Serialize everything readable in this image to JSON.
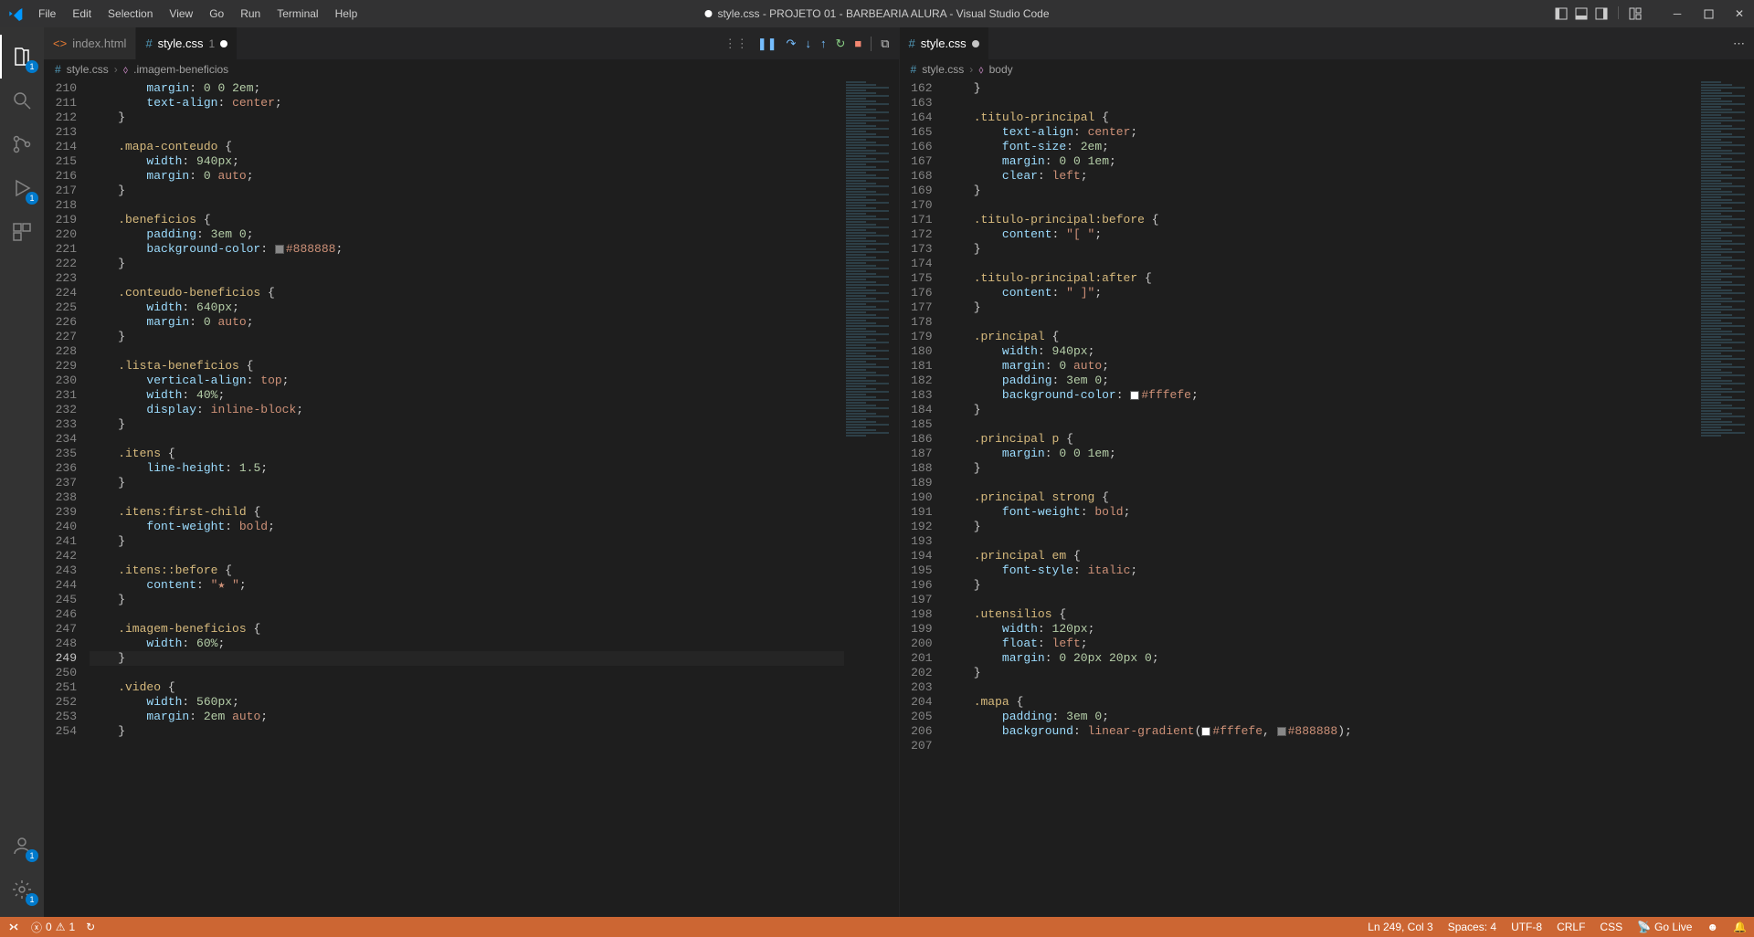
{
  "menu": [
    "File",
    "Edit",
    "Selection",
    "View",
    "Go",
    "Run",
    "Terminal",
    "Help"
  ],
  "window_title": "style.css - PROJETO 01 - BARBEARIA ALURA - Visual Studio Code",
  "activity": {
    "explorer_badge": "1",
    "debug_badge": "1",
    "accounts_badge": "1",
    "settings_badge": "1"
  },
  "left_editor": {
    "tabs": [
      {
        "icon": "html",
        "label": "index.html",
        "dirty": false
      },
      {
        "icon": "css",
        "label": "style.css",
        "num": "1",
        "dirty": true
      }
    ],
    "breadcrumb": {
      "file": "style.css",
      "symbol": ".imagem-beneficios"
    },
    "first_line": 210,
    "current_line": 249,
    "lines": [
      {
        "t": "prop",
        "raw": "        margin: 0 0 2em;"
      },
      {
        "t": "prop",
        "raw": "        text-align: center;"
      },
      {
        "t": "brace",
        "raw": "    }"
      },
      {
        "t": "",
        "raw": ""
      },
      {
        "t": "sel",
        "raw": "    .mapa-conteudo {"
      },
      {
        "t": "prop",
        "raw": "        width: 940px;"
      },
      {
        "t": "prop",
        "raw": "        margin: 0 auto;"
      },
      {
        "t": "brace",
        "raw": "    }"
      },
      {
        "t": "",
        "raw": ""
      },
      {
        "t": "sel",
        "raw": "    .beneficios {"
      },
      {
        "t": "prop",
        "raw": "        padding: 3em 0;"
      },
      {
        "t": "color",
        "raw": "        background-color: #888888;",
        "swatch": "#888888"
      },
      {
        "t": "brace",
        "raw": "    }"
      },
      {
        "t": "",
        "raw": ""
      },
      {
        "t": "sel",
        "raw": "    .conteudo-beneficios {"
      },
      {
        "t": "prop",
        "raw": "        width: 640px;"
      },
      {
        "t": "prop",
        "raw": "        margin: 0 auto;"
      },
      {
        "t": "brace",
        "raw": "    }"
      },
      {
        "t": "",
        "raw": ""
      },
      {
        "t": "sel",
        "raw": "    .lista-beneficios {"
      },
      {
        "t": "prop",
        "raw": "        vertical-align: top;"
      },
      {
        "t": "prop",
        "raw": "        width: 40%;"
      },
      {
        "t": "prop",
        "raw": "        display: inline-block;"
      },
      {
        "t": "brace",
        "raw": "    }"
      },
      {
        "t": "",
        "raw": ""
      },
      {
        "t": "sel",
        "raw": "    .itens {"
      },
      {
        "t": "prop",
        "raw": "        line-height: 1.5;"
      },
      {
        "t": "brace",
        "raw": "    }"
      },
      {
        "t": "",
        "raw": ""
      },
      {
        "t": "sel",
        "raw": "    .itens:first-child {"
      },
      {
        "t": "prop",
        "raw": "        font-weight: bold;"
      },
      {
        "t": "brace",
        "raw": "    }"
      },
      {
        "t": "",
        "raw": ""
      },
      {
        "t": "sel",
        "raw": "    .itens::before {"
      },
      {
        "t": "str",
        "raw": "        content: \"★ \";"
      },
      {
        "t": "brace",
        "raw": "    }"
      },
      {
        "t": "",
        "raw": ""
      },
      {
        "t": "sel",
        "raw": "    .imagem-beneficios {"
      },
      {
        "t": "prop",
        "raw": "        width: 60%;"
      },
      {
        "t": "brace",
        "raw": "    }"
      },
      {
        "t": "",
        "raw": ""
      },
      {
        "t": "sel",
        "raw": "    .video {"
      },
      {
        "t": "prop",
        "raw": "        width: 560px;"
      },
      {
        "t": "prop",
        "raw": "        margin: 2em auto;"
      },
      {
        "t": "brace",
        "raw": "    }"
      }
    ]
  },
  "right_editor": {
    "tab": {
      "icon": "css",
      "label": "style.css"
    },
    "breadcrumb": {
      "file": "style.css",
      "symbol": "body"
    },
    "first_line": 162,
    "lines": [
      {
        "t": "brace",
        "raw": "    }"
      },
      {
        "t": "",
        "raw": ""
      },
      {
        "t": "sel",
        "raw": "    .titulo-principal {"
      },
      {
        "t": "prop",
        "raw": "        text-align: center;"
      },
      {
        "t": "prop",
        "raw": "        font-size: 2em;"
      },
      {
        "t": "prop",
        "raw": "        margin: 0 0 1em;"
      },
      {
        "t": "prop",
        "raw": "        clear: left;"
      },
      {
        "t": "brace",
        "raw": "    }"
      },
      {
        "t": "",
        "raw": ""
      },
      {
        "t": "sel",
        "raw": "    .titulo-principal:before {"
      },
      {
        "t": "str",
        "raw": "        content: \"[ \";"
      },
      {
        "t": "brace",
        "raw": "    }"
      },
      {
        "t": "",
        "raw": ""
      },
      {
        "t": "sel",
        "raw": "    .titulo-principal:after {"
      },
      {
        "t": "str",
        "raw": "        content: \" ]\";"
      },
      {
        "t": "brace",
        "raw": "    }"
      },
      {
        "t": "",
        "raw": ""
      },
      {
        "t": "sel",
        "raw": "    .principal {"
      },
      {
        "t": "prop",
        "raw": "        width: 940px;"
      },
      {
        "t": "prop",
        "raw": "        margin: 0 auto;"
      },
      {
        "t": "prop",
        "raw": "        padding: 3em 0;"
      },
      {
        "t": "color",
        "raw": "        background-color: #fffefe;",
        "swatch": "#fffefe"
      },
      {
        "t": "brace",
        "raw": "    }"
      },
      {
        "t": "",
        "raw": ""
      },
      {
        "t": "sel",
        "raw": "    .principal p {"
      },
      {
        "t": "prop",
        "raw": "        margin: 0 0 1em;"
      },
      {
        "t": "brace",
        "raw": "    }"
      },
      {
        "t": "",
        "raw": ""
      },
      {
        "t": "sel",
        "raw": "    .principal strong {"
      },
      {
        "t": "prop",
        "raw": "        font-weight: bold;"
      },
      {
        "t": "brace",
        "raw": "    }"
      },
      {
        "t": "",
        "raw": ""
      },
      {
        "t": "sel",
        "raw": "    .principal em {"
      },
      {
        "t": "prop",
        "raw": "        font-style: italic;"
      },
      {
        "t": "brace",
        "raw": "    }"
      },
      {
        "t": "",
        "raw": ""
      },
      {
        "t": "sel",
        "raw": "    .utensilios {"
      },
      {
        "t": "prop",
        "raw": "        width: 120px;"
      },
      {
        "t": "prop",
        "raw": "        float: left;"
      },
      {
        "t": "prop",
        "raw": "        margin: 0 20px 20px 0;"
      },
      {
        "t": "brace",
        "raw": "    }"
      },
      {
        "t": "",
        "raw": ""
      },
      {
        "t": "sel",
        "raw": "    .mapa {"
      },
      {
        "t": "prop",
        "raw": "        padding: 3em 0;"
      },
      {
        "t": "color2",
        "raw": "        background: linear-gradient(#fffefe, #888888);",
        "sw1": "#fffefe",
        "sw2": "#888888"
      },
      {
        "t": "",
        "raw": ""
      }
    ]
  },
  "status": {
    "errors": "0",
    "warnings": "1",
    "lncol": "Ln 249, Col 3",
    "spaces": "Spaces: 4",
    "encoding": "UTF-8",
    "eol": "CRLF",
    "lang": "CSS",
    "golive": "Go Live"
  }
}
